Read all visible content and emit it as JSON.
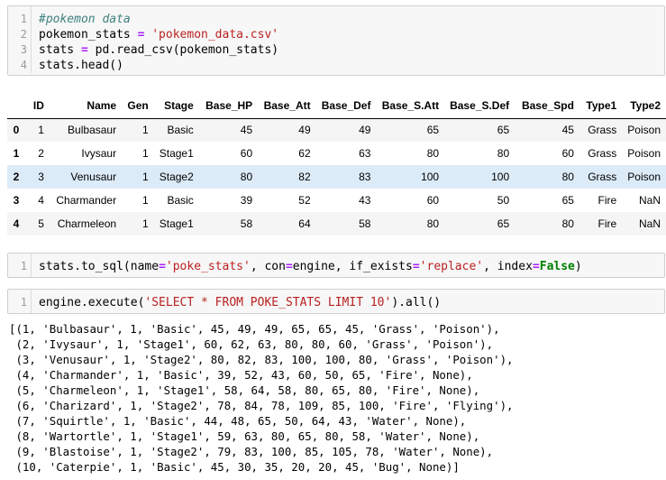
{
  "cell1": {
    "line_numbers": [
      "1",
      "2",
      "3",
      "4"
    ],
    "comment": "#pokemon data",
    "l2_a": "pokemon_stats ",
    "l2_op": "=",
    "l2_b": " ",
    "l2_str": "'pokemon_data.csv'",
    "l3_a": "stats ",
    "l3_op": "=",
    "l3_b": " pd.read_csv(pokemon_stats)",
    "l4": "stats.head()"
  },
  "dataframe": {
    "columns": [
      "",
      "ID",
      "Name",
      "Gen",
      "Stage",
      "Base_HP",
      "Base_Att",
      "Base_Def",
      "Base_S.Att",
      "Base_S.Def",
      "Base_Spd",
      "Type1",
      "Type2"
    ],
    "rows": [
      [
        "0",
        "1",
        "Bulbasaur",
        "1",
        "Basic",
        "45",
        "49",
        "49",
        "65",
        "65",
        "45",
        "Grass",
        "Poison"
      ],
      [
        "1",
        "2",
        "Ivysaur",
        "1",
        "Stage1",
        "60",
        "62",
        "63",
        "80",
        "80",
        "60",
        "Grass",
        "Poison"
      ],
      [
        "2",
        "3",
        "Venusaur",
        "1",
        "Stage2",
        "80",
        "82",
        "83",
        "100",
        "100",
        "80",
        "Grass",
        "Poison"
      ],
      [
        "3",
        "4",
        "Charmander",
        "1",
        "Basic",
        "39",
        "52",
        "43",
        "60",
        "50",
        "65",
        "Fire",
        "NaN"
      ],
      [
        "4",
        "5",
        "Charmeleon",
        "1",
        "Stage1",
        "58",
        "64",
        "58",
        "80",
        "65",
        "80",
        "Fire",
        "NaN"
      ]
    ],
    "highlighted_row_index": 2
  },
  "cell2": {
    "line_number": "1",
    "a": "stats.to_sql(name",
    "op1": "=",
    "s1": "'poke_stats'",
    "b": ", con",
    "op2": "=",
    "c": "engine, if_exists",
    "op3": "=",
    "s2": "'replace'",
    "d": ", index",
    "op4": "=",
    "kw": "False",
    "e": ")"
  },
  "cell3": {
    "line_number": "1",
    "a": "engine.execute(",
    "s": "'SELECT * FROM POKE_STATS LIMIT 10'",
    "b": ").all()"
  },
  "output": {
    "lines": [
      "[(1, 'Bulbasaur', 1, 'Basic', 45, 49, 49, 65, 65, 45, 'Grass', 'Poison'),",
      " (2, 'Ivysaur', 1, 'Stage1', 60, 62, 63, 80, 80, 60, 'Grass', 'Poison'),",
      " (3, 'Venusaur', 1, 'Stage2', 80, 82, 83, 100, 100, 80, 'Grass', 'Poison'),",
      " (4, 'Charmander', 1, 'Basic', 39, 52, 43, 60, 50, 65, 'Fire', None),",
      " (5, 'Charmeleon', 1, 'Stage1', 58, 64, 58, 80, 65, 80, 'Fire', None),",
      " (6, 'Charizard', 1, 'Stage2', 78, 84, 78, 109, 85, 100, 'Fire', 'Flying'),",
      " (7, 'Squirtle', 1, 'Basic', 44, 48, 65, 50, 64, 43, 'Water', None),",
      " (8, 'Wartortle', 1, 'Stage1', 59, 63, 80, 65, 80, 58, 'Water', None),",
      " (9, 'Blastoise', 1, 'Stage2', 79, 83, 100, 85, 105, 78, 'Water', None),",
      " (10, 'Caterpie', 1, 'Basic', 45, 30, 35, 20, 20, 45, 'Bug', None)]"
    ]
  }
}
